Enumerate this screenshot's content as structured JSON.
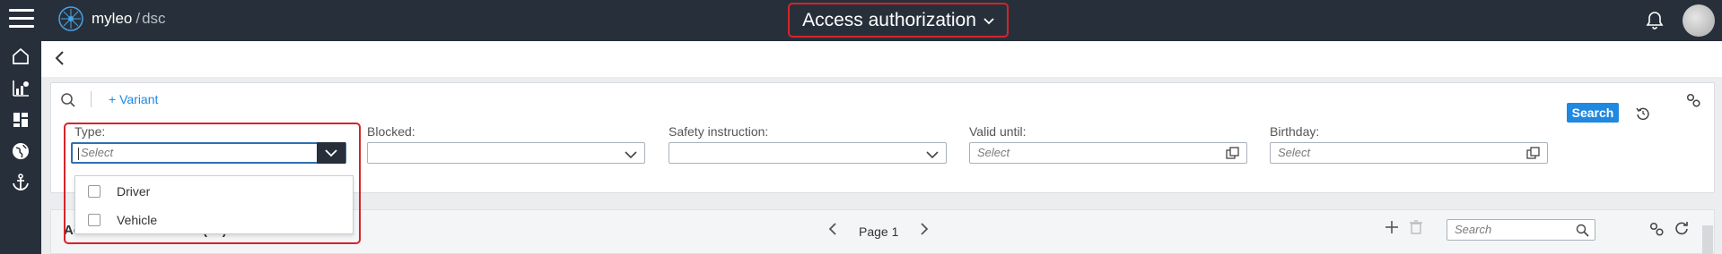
{
  "header": {
    "app_name": "myleo",
    "app_suffix": "dsc",
    "app_separator": "/",
    "page_title": "Access authorization"
  },
  "sidebar": {
    "items": [
      {
        "icon": "home-icon"
      },
      {
        "icon": "chart-icon"
      },
      {
        "icon": "dashboard-icon"
      },
      {
        "icon": "globe-icon"
      },
      {
        "icon": "anchor-icon"
      }
    ]
  },
  "filters": {
    "variant_label": "+ Variant",
    "type": {
      "label": "Type:",
      "placeholder": "Select"
    },
    "blocked": {
      "label": "Blocked:",
      "value": ""
    },
    "safety_instruction": {
      "label": "Safety instruction:",
      "value": ""
    },
    "valid_until": {
      "label": "Valid until:",
      "placeholder": "Select"
    },
    "birthday": {
      "label": "Birthday:",
      "placeholder": "Select"
    },
    "search_button": "Search"
  },
  "type_dropdown": {
    "options": [
      {
        "label": "Driver",
        "checked": false
      },
      {
        "label": "Vehicle",
        "checked": false
      }
    ]
  },
  "table": {
    "title": "Access authorization (17)",
    "page_label": "Page 1",
    "search_placeholder": "Search"
  },
  "colors": {
    "topbar": "#27303a",
    "accent": "#1f88e0",
    "highlight": "#d6232a"
  }
}
